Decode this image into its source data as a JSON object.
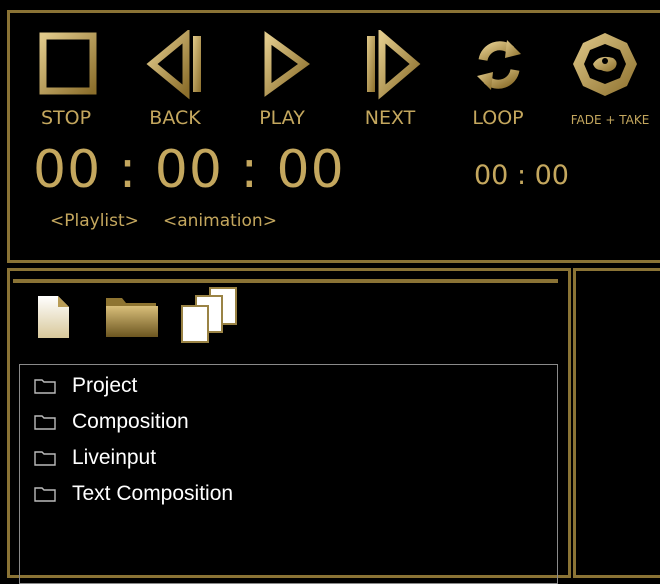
{
  "transport": {
    "stop_label": "STOP",
    "back_label": "BACK",
    "play_label": "PLAY",
    "next_label": "NEXT",
    "loop_label": "LOOP",
    "fade_take_label": "FADE + TAKE"
  },
  "timecode": {
    "main": "00 : 00 : 00",
    "secondary": "00 : 00",
    "playlist_label": "<Playlist>",
    "animation_label": "<animation>"
  },
  "toolbar": {
    "icons": [
      "new-file-icon",
      "open-folder-icon",
      "copy-pages-icon"
    ]
  },
  "tree": {
    "items": [
      {
        "label": "Project",
        "icon": "folder-icon"
      },
      {
        "label": "Composition",
        "icon": "folder-icon"
      },
      {
        "label": "Liveinput",
        "icon": "folder-icon"
      },
      {
        "label": "Text Composition",
        "icon": "folder-icon"
      }
    ]
  },
  "colors": {
    "gold": "#c4a75e",
    "frame": "#8a7335",
    "background": "#000000"
  }
}
